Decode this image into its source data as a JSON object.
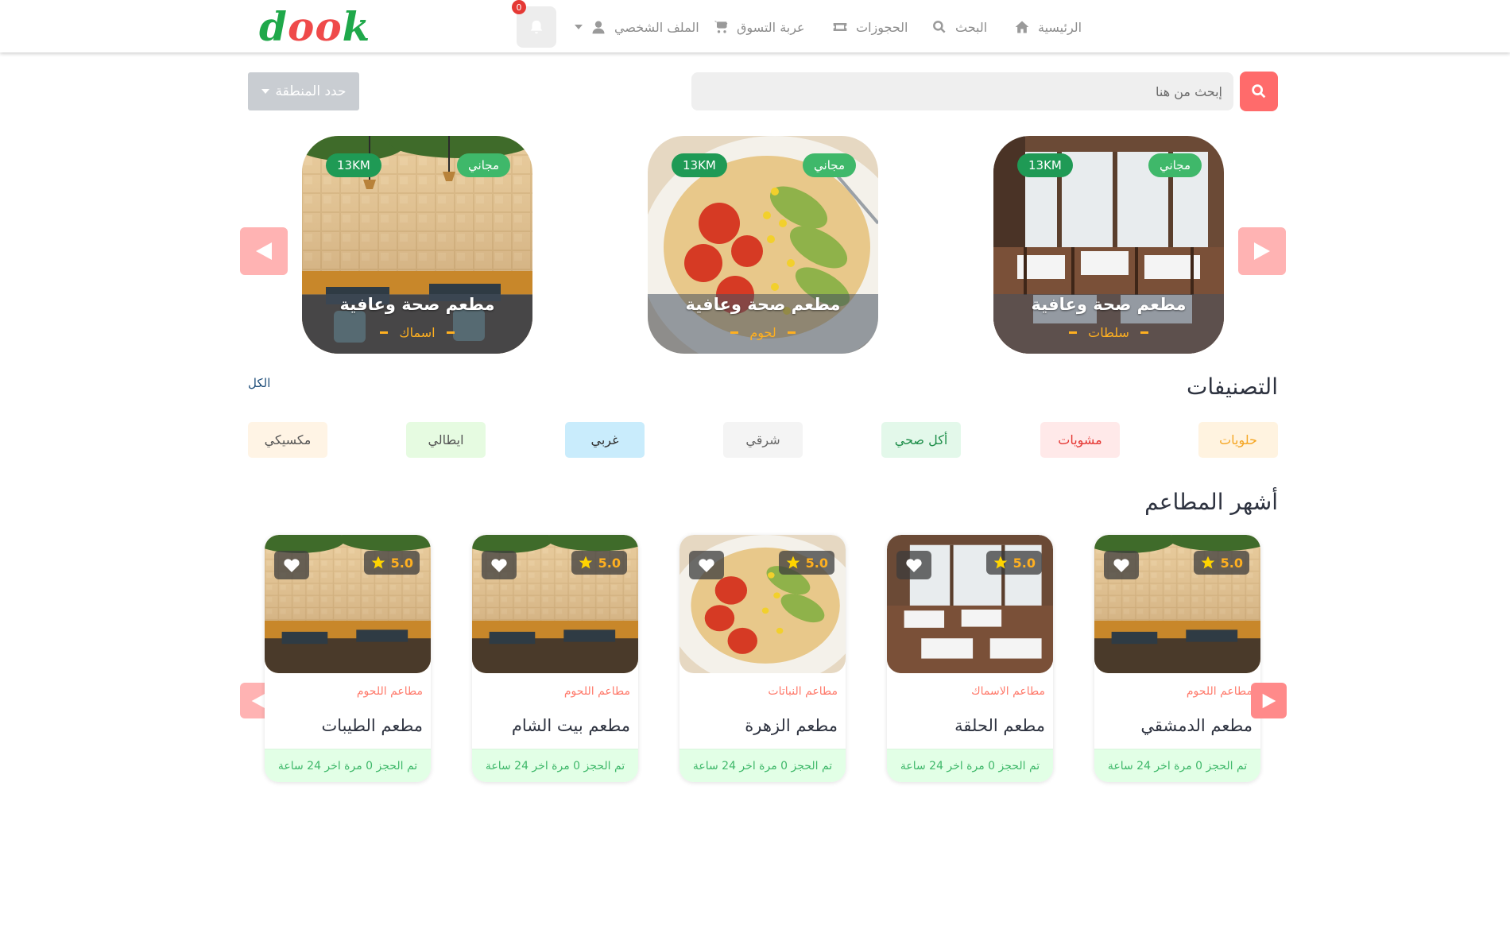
{
  "brand": {
    "logo_d": "d",
    "logo_oo": "oo",
    "logo_k": "k"
  },
  "nav": {
    "home": "الرئيسية",
    "search": "البحث",
    "bookings": "الحجوزات",
    "cart": "عربة التسوق",
    "profile": "الملف الشخصي",
    "notifications_count": "0"
  },
  "search": {
    "placeholder": "إبحث من هنا"
  },
  "region": {
    "label": "حدد المنطقة"
  },
  "featured": [
    {
      "title": "مطعم صحة وعافية",
      "subtitle": "سلطات",
      "free": "مجاني",
      "distance": "13KM"
    },
    {
      "title": "مطعم صحة وعافية",
      "subtitle": "لحوم",
      "free": "مجاني",
      "distance": "13KM"
    },
    {
      "title": "مطعم صحة وعافية",
      "subtitle": "اسماك",
      "free": "مجاني",
      "distance": "13KM"
    }
  ],
  "categories": {
    "title": "التصنيفات",
    "all": "الكل",
    "items": [
      {
        "label": "حلويات",
        "bg": "#fff3e0",
        "color": "#f5a623"
      },
      {
        "label": "مشويات",
        "bg": "#ffe9e9",
        "color": "#e53935"
      },
      {
        "label": "أكل صحي",
        "bg": "#e3f8ea",
        "color": "#1e8e4a"
      },
      {
        "label": "شرقي",
        "bg": "#f4f4f4",
        "color": "#666666"
      },
      {
        "label": "غربي",
        "bg": "#c9ecfc",
        "color": "#333333"
      },
      {
        "label": "ايطالي",
        "bg": "#e6fbe1",
        "color": "#555555"
      },
      {
        "label": "مكسيكي",
        "bg": "#fff4e5",
        "color": "#555555"
      }
    ]
  },
  "popular": {
    "title": "أشهر المطاعم",
    "items": [
      {
        "name": "مطعم الدمشقي",
        "category": "مطاعم اللحوم",
        "rating": "5.0",
        "bookings": "تم الحجز 0 مرة اخر 24 ساعة"
      },
      {
        "name": "مطعم الحلقة",
        "category": "مطاعم الاسماك",
        "rating": "5.0",
        "bookings": "تم الحجز 0 مرة اخر 24 ساعة"
      },
      {
        "name": "مطعم الزهرة",
        "category": "مطاعم النباتات",
        "rating": "5.0",
        "bookings": "تم الحجز 0 مرة اخر 24 ساعة"
      },
      {
        "name": "مطعم بيت الشام",
        "category": "مطاعم اللحوم",
        "rating": "5.0",
        "bookings": "تم الحجز 0 مرة اخر 24 ساعة"
      },
      {
        "name": "مطعم الطيبات",
        "category": "مطاعم اللحوم",
        "rating": "5.0",
        "bookings": "تم الحجز 0 مرة اخر 24 ساعة"
      }
    ]
  },
  "colors": {
    "accent": "#ff6b6b",
    "brand_green": "#1fa84a",
    "arrow": "#ffb3b3",
    "free_pill": "#3fb86a"
  }
}
